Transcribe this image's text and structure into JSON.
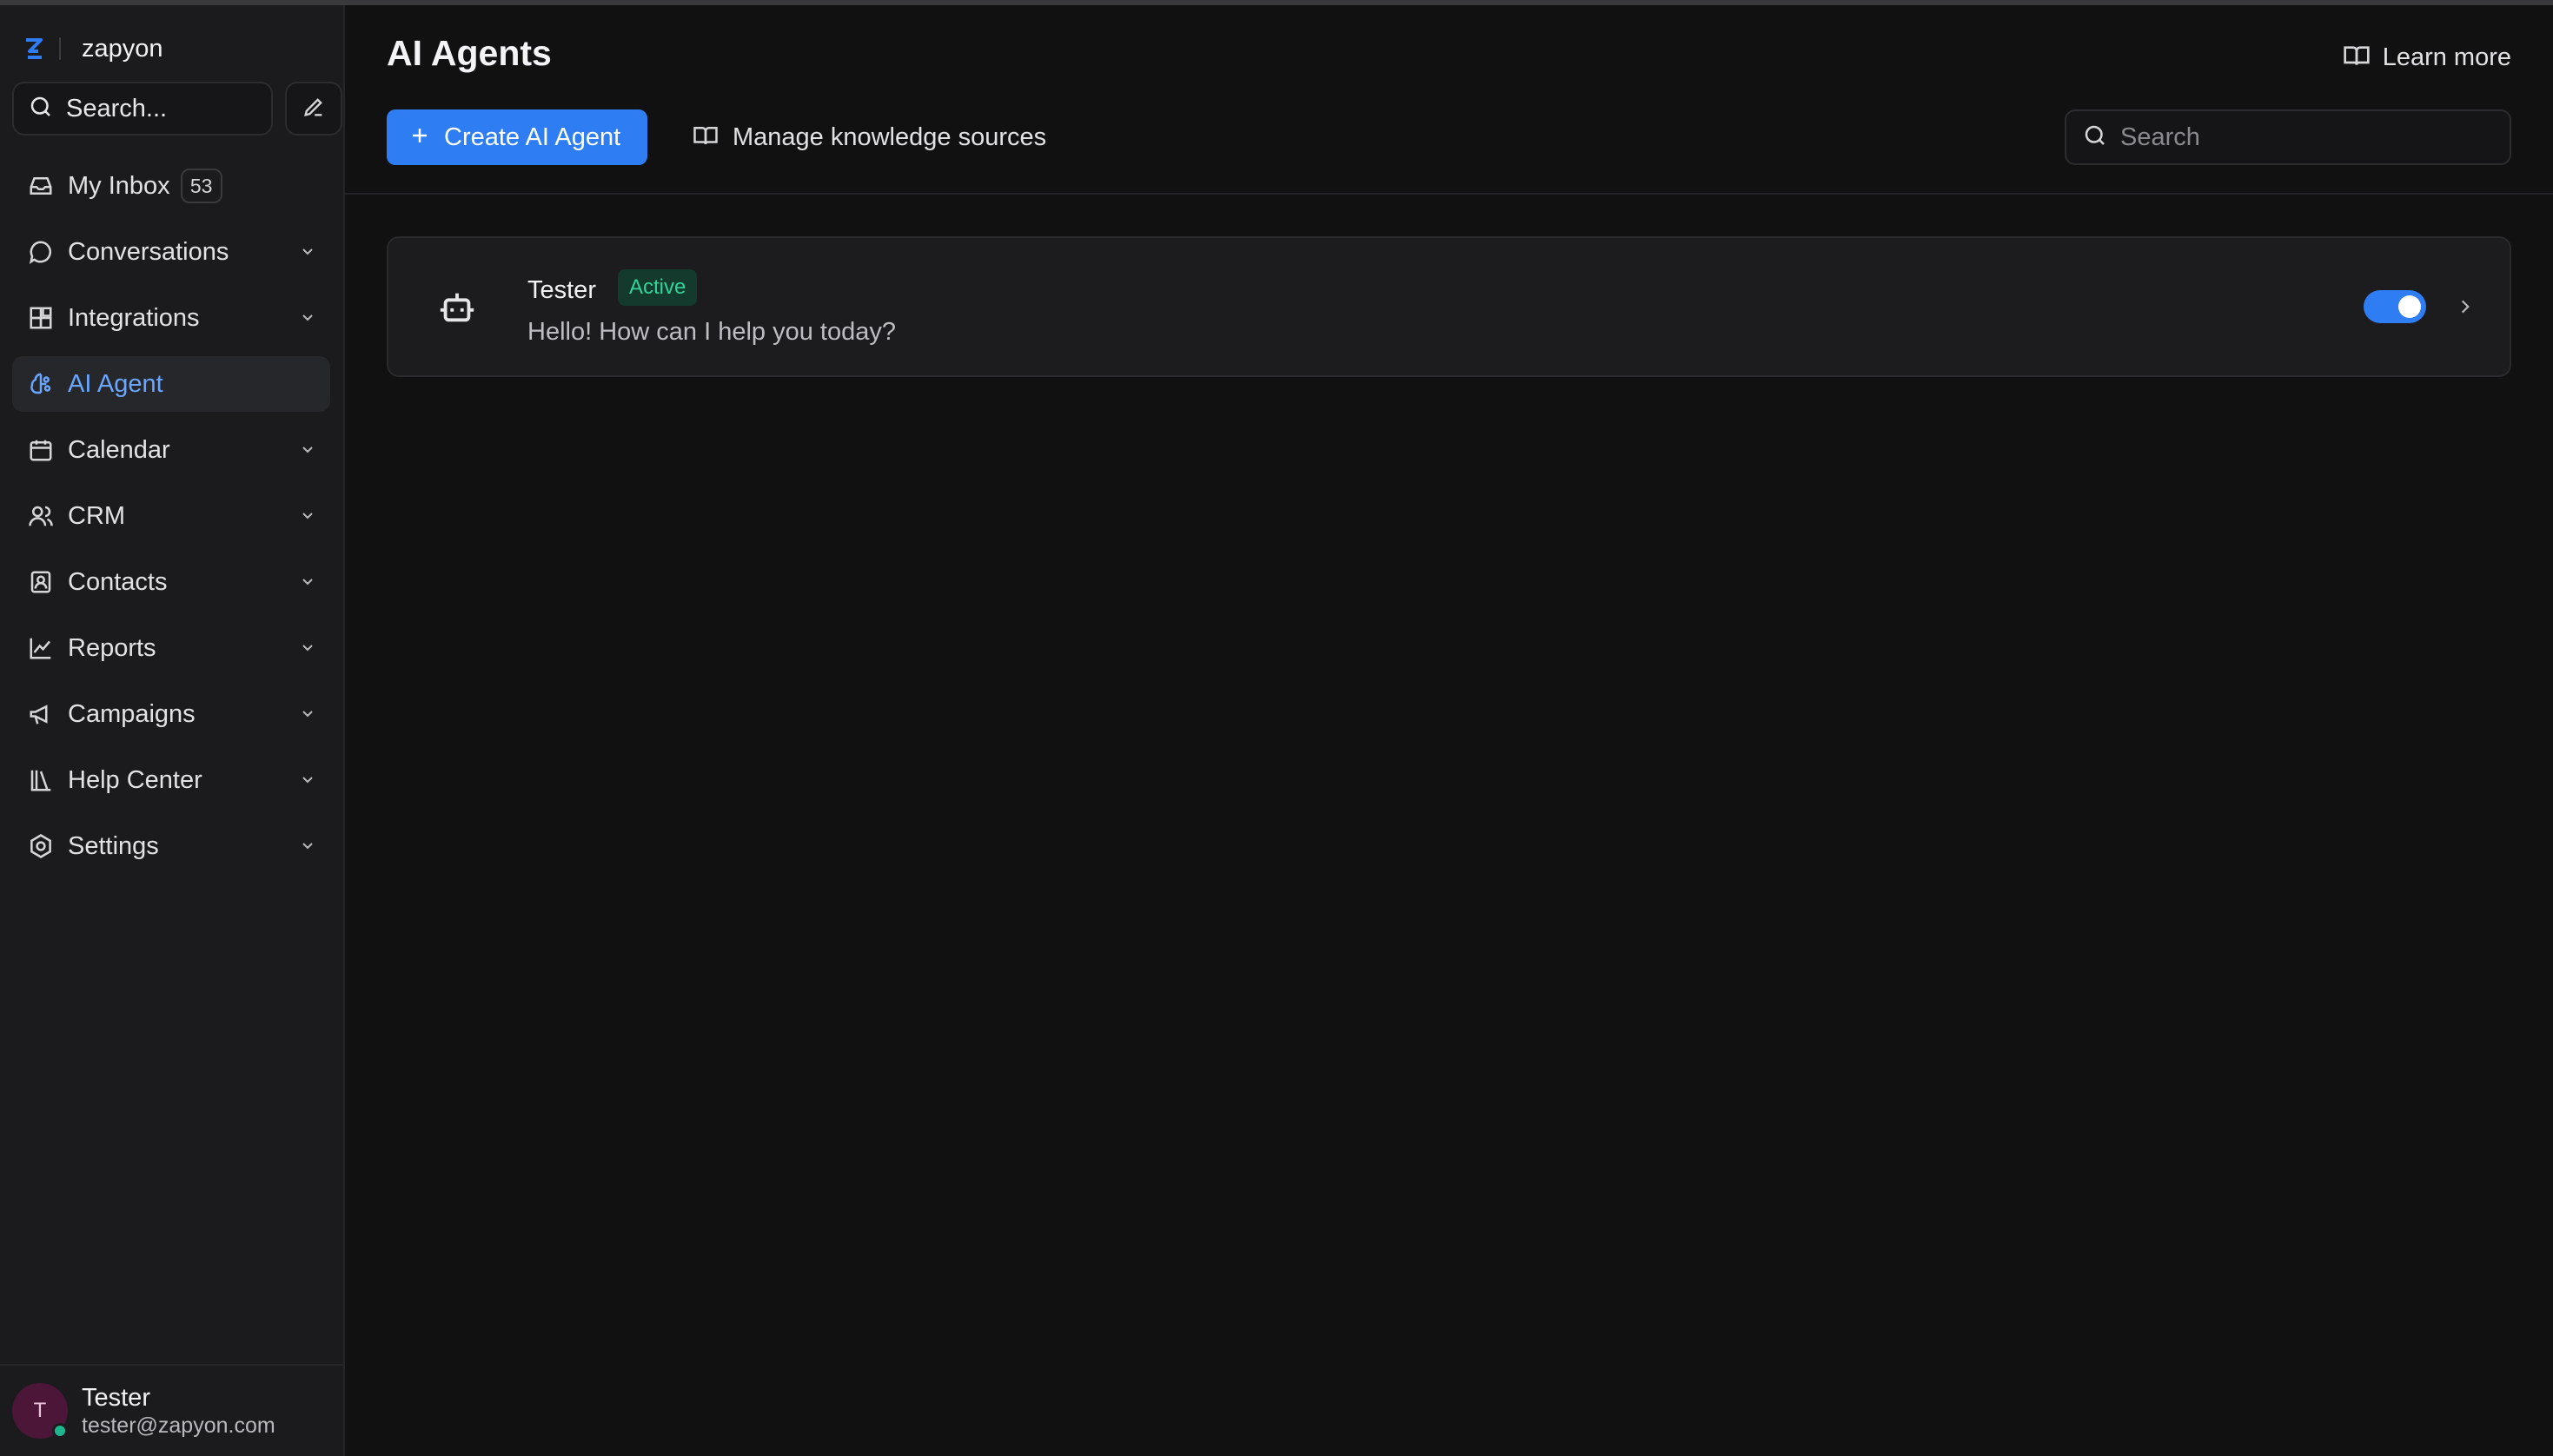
{
  "brand": {
    "name": "zapyon"
  },
  "sidebar": {
    "search_label": "Search...",
    "items": [
      {
        "label": "My Inbox",
        "badge": "53",
        "icon": "inbox-icon"
      },
      {
        "label": "Conversations",
        "icon": "chat-icon"
      },
      {
        "label": "Integrations",
        "icon": "integrations-icon"
      },
      {
        "label": "AI Agent",
        "icon": "ai-agent-icon",
        "active": true
      },
      {
        "label": "Calendar",
        "icon": "calendar-icon"
      },
      {
        "label": "CRM",
        "icon": "users-icon"
      },
      {
        "label": "Contacts",
        "icon": "contact-card-icon"
      },
      {
        "label": "Reports",
        "icon": "chart-icon"
      },
      {
        "label": "Campaigns",
        "icon": "megaphone-icon"
      },
      {
        "label": "Help Center",
        "icon": "library-icon"
      },
      {
        "label": "Settings",
        "icon": "settings-icon"
      }
    ]
  },
  "user": {
    "initial": "T",
    "name": "Tester",
    "email": "tester@zapyon.com"
  },
  "main": {
    "title": "AI Agents",
    "learn_more": "Learn more",
    "create_button": "Create AI Agent",
    "manage_button": "Manage knowledge sources",
    "search_placeholder": "Search",
    "agents": [
      {
        "name": "Tester",
        "status": "Active",
        "description": "Hello! How can I help you today?",
        "enabled": true
      }
    ]
  },
  "colors": {
    "accent": "#2f7df2",
    "active_text": "#6aa6ff",
    "status_green": "#34d39a",
    "background": "#111112",
    "sidebar": "#1b1b1d"
  }
}
